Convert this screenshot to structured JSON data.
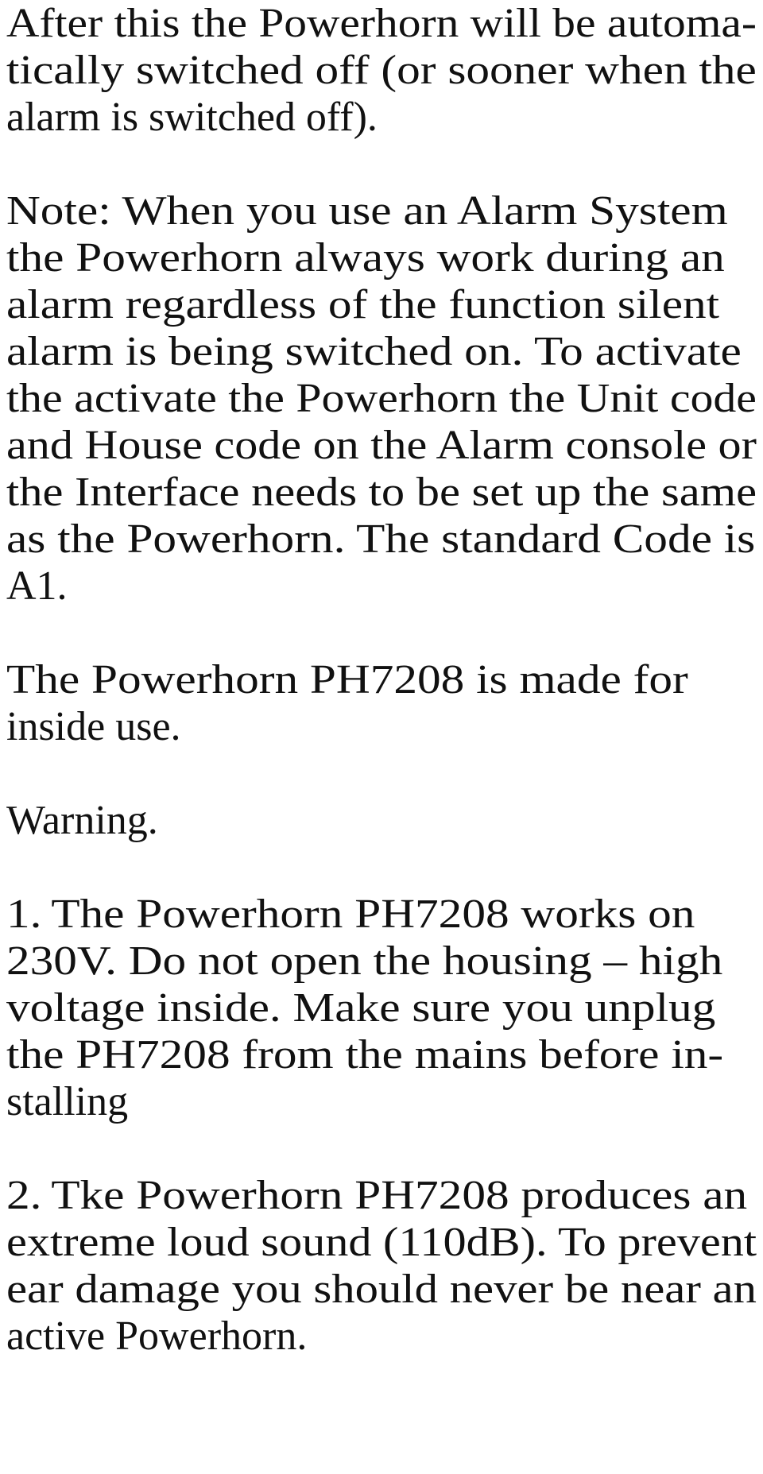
{
  "document": {
    "page_background": "#ffffff",
    "text_color": "#111111",
    "blocks": [
      {
        "id": "para-auto-switch-off",
        "type": "paragraph",
        "text": "After this the Powerhorn will be automatically switched off (or sooner when the alarm is switched off).",
        "lines": [
          {
            "text": "After this the Powerhorn will be automa-",
            "scale": 1.0
          },
          {
            "text": "tically switched off (or sooner when the",
            "scale": 1.0
          },
          {
            "text": "alarm is switched off).",
            "scale": 1.0
          }
        ]
      },
      {
        "id": "para-note-alarm-system",
        "type": "paragraph",
        "text": "Note: When you use an Alarm System the Powerhorn always work during an alarm regardless of the function silent alarm is being switched on. To activate the activate the Powerhorn the Unit code and House code on the Alarm console or the Interface needs to be set up the same as the Powerhorn. The standard Code is A1.",
        "lines": [
          {
            "text": "Note: When you use an Alarm System",
            "scale": 1.0
          },
          {
            "text": "the Powerhorn always work during an",
            "scale": 1.0
          },
          {
            "text": "alarm regardless of the function silent",
            "scale": 1.0
          },
          {
            "text": "alarm is being switched on. To activate",
            "scale": 1.0
          },
          {
            "text": "the activate the Powerhorn the Unit code",
            "scale": 1.0
          },
          {
            "text": "and House code on the Alarm console or",
            "scale": 1.0
          },
          {
            "text": "the Interface needs to be set up the same",
            "scale": 1.0
          },
          {
            "text": "as the Powerhorn. The standard Code is",
            "scale": 1.0
          },
          {
            "text": "A1.",
            "scale": 1.0
          }
        ]
      },
      {
        "id": "para-inside-use",
        "type": "paragraph",
        "text": "The Powerhorn PH7208 is made for inside use.",
        "lines": [
          {
            "text": "The Powerhorn PH7208 is made for",
            "scale": 1.0
          },
          {
            "text": "inside use.",
            "scale": 1.0
          }
        ]
      },
      {
        "id": "heading-warning",
        "type": "heading",
        "text": "Warning.",
        "lines": [
          {
            "text": "Warning.",
            "scale": 1.0
          }
        ]
      },
      {
        "id": "list-item-1",
        "type": "list-item",
        "marker": "1.",
        "text": "The Powerhorn PH7208 works on 230V. Do not open the housing – high voltage inside. Make sure you unplug the PH7208 from the mains before installing",
        "lines": [
          {
            "text": "1. The Powerhorn PH7208 works on",
            "scale": 1.0
          },
          {
            "text": "230V. Do not open the housing – high",
            "scale": 1.0
          },
          {
            "text": "voltage inside. Make sure you unplug",
            "scale": 1.0
          },
          {
            "text": "the PH7208 from the mains before in-",
            "scale": 1.0
          },
          {
            "text": "stalling",
            "scale": 1.0
          }
        ]
      },
      {
        "id": "list-item-2",
        "type": "list-item",
        "marker": "2.",
        "text": "Tke Powerhorn PH7208 produces an extreme loud sound (110dB). To prevent ear damage you should never be near an active Powerhorn.",
        "lines": [
          {
            "text": "2. Tke Powerhorn PH7208 produces an",
            "scale": 1.0
          },
          {
            "text": "extreme loud sound (110dB). To prevent",
            "scale": 1.0
          },
          {
            "text": "ear damage you should never be near an",
            "scale": 1.0
          },
          {
            "text": "active Powerhorn.",
            "scale": 1.0
          }
        ]
      }
    ]
  }
}
